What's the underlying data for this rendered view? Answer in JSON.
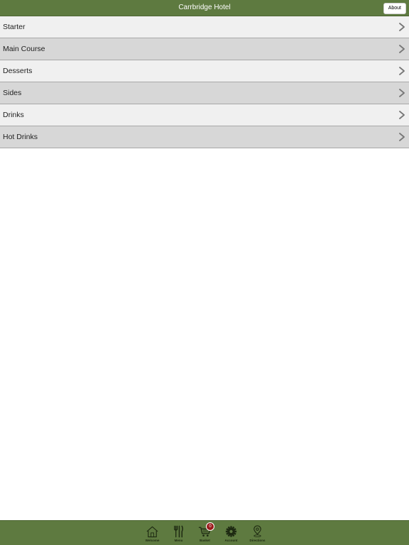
{
  "header": {
    "title": "Carrbridge Hotel",
    "about_label": "About"
  },
  "menu": {
    "items": [
      {
        "label": "Starter"
      },
      {
        "label": "Main Course"
      },
      {
        "label": "Desserts"
      },
      {
        "label": "Sides"
      },
      {
        "label": "Drinks"
      },
      {
        "label": "Hot Drinks"
      }
    ]
  },
  "tabbar": {
    "tabs": [
      {
        "label": "Welcome",
        "icon": "home-icon"
      },
      {
        "label": "Menu",
        "icon": "cutlery-icon"
      },
      {
        "label": "Basket",
        "icon": "cart-icon",
        "badge": "0"
      },
      {
        "label": "Account",
        "icon": "gear-icon"
      },
      {
        "label": "Directions",
        "icon": "map-pin-icon"
      }
    ]
  },
  "colors": {
    "header_bg": "#5e7a40",
    "row_light": "#f0f0f0",
    "row_dark": "#d7d7d7",
    "badge_bg": "#9a1b1b"
  }
}
